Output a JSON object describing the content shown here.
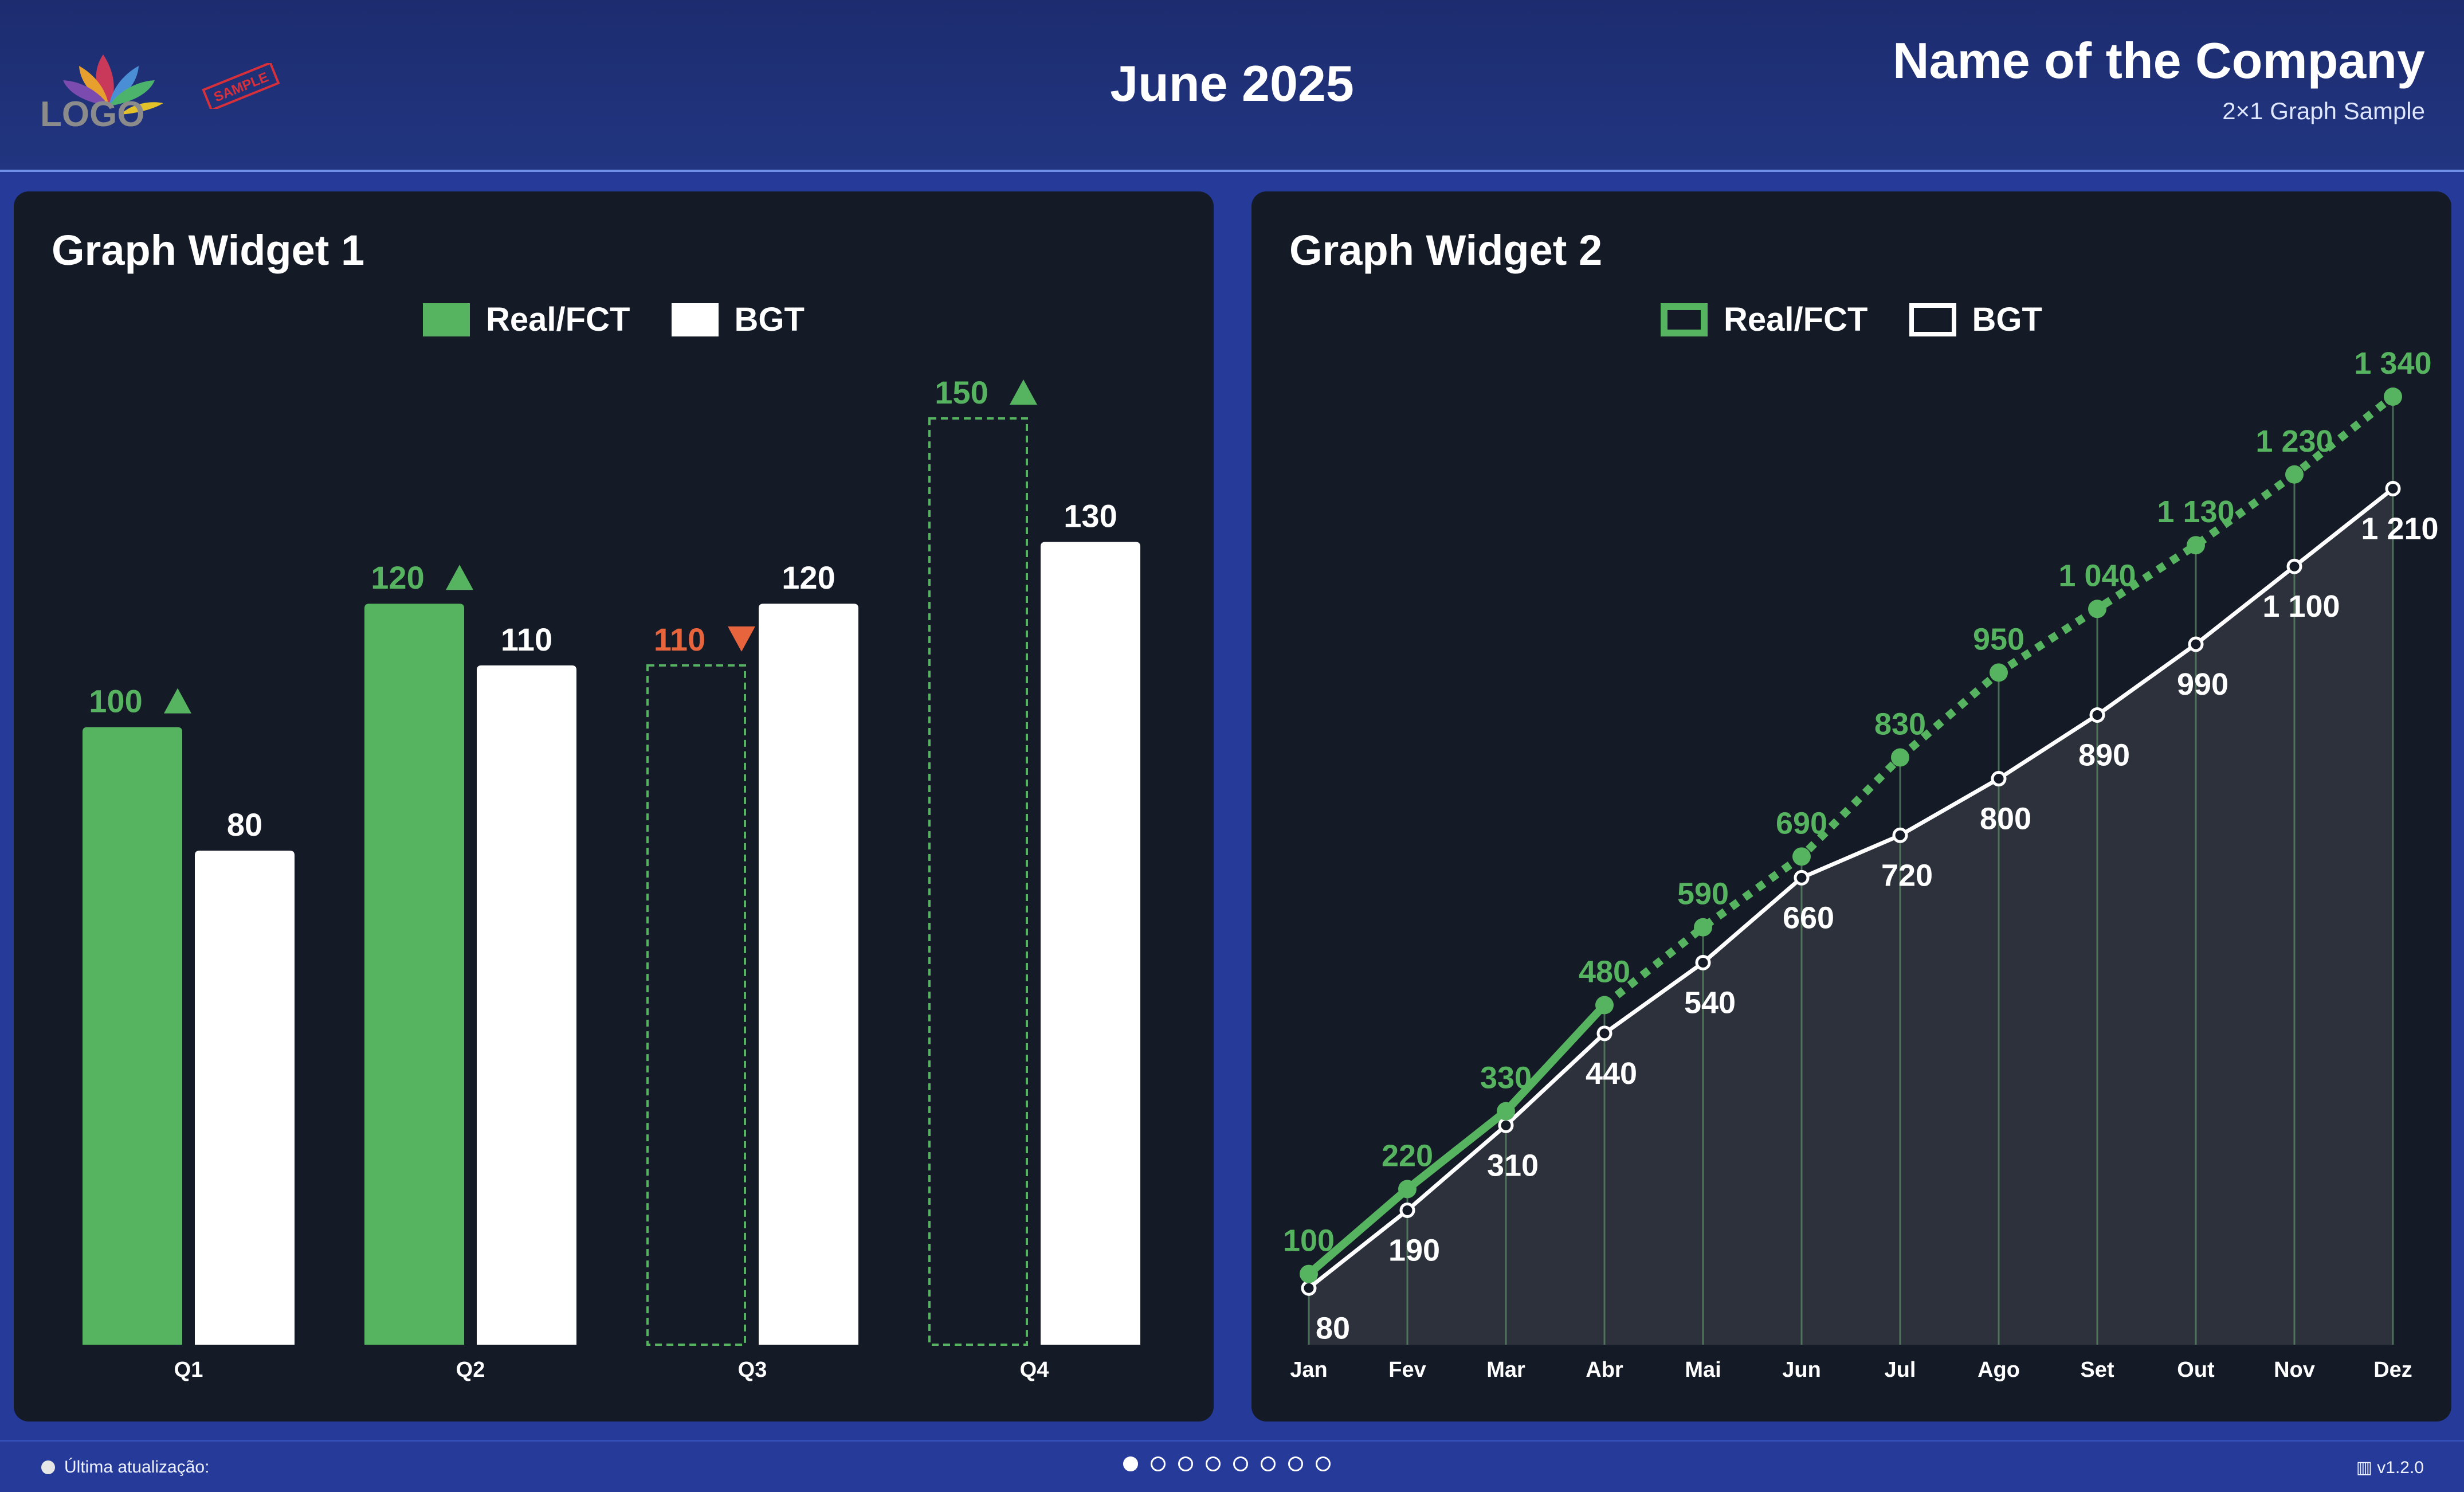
{
  "header": {
    "logo_text": "LOGO",
    "sample_stamp": "SAMPLE",
    "title": "June 2025",
    "company": "Name of the Company",
    "subtitle": "2×1 Graph Sample"
  },
  "colors": {
    "green": "#56b35f",
    "white": "#ffffff",
    "red": "#e8643c",
    "panel": "#141a26",
    "background": "#253a99"
  },
  "widget1": {
    "title": "Graph Widget 1",
    "legend": [
      "Real/FCT",
      "BGT"
    ]
  },
  "widget2": {
    "title": "Graph Widget 2",
    "legend": [
      "Real/FCT",
      "BGT"
    ]
  },
  "chart_data": [
    {
      "type": "bar",
      "title": "Graph Widget 1",
      "categories": [
        "Q1",
        "Q2",
        "Q3",
        "Q4"
      ],
      "series": [
        {
          "name": "Real/FCT",
          "values": [
            100,
            120,
            110,
            150
          ],
          "status": [
            "actual",
            "actual",
            "forecast",
            "forecast"
          ],
          "trend": [
            "up",
            "up",
            "down",
            "up"
          ]
        },
        {
          "name": "BGT",
          "values": [
            80,
            110,
            120,
            130
          ]
        }
      ],
      "ylim": [
        0,
        150
      ],
      "legend": "top-center",
      "grid": false
    },
    {
      "type": "line",
      "title": "Graph Widget 2",
      "categories": [
        "Jan",
        "Fev",
        "Mar",
        "Abr",
        "Mai",
        "Jun",
        "Jul",
        "Ago",
        "Set",
        "Out",
        "Nov",
        "Dez"
      ],
      "series": [
        {
          "name": "Real/FCT",
          "values": [
            100,
            220,
            330,
            480,
            590,
            690,
            830,
            950,
            1040,
            1130,
            1230,
            1340
          ],
          "labels": [
            "100",
            "220",
            "330",
            "480",
            "590",
            "690",
            "830",
            "950",
            "1 040",
            "1 130",
            "1 230",
            "1 340"
          ],
          "actual_count": 4
        },
        {
          "name": "BGT",
          "values": [
            80,
            190,
            310,
            440,
            540,
            660,
            720,
            800,
            890,
            990,
            1100,
            1210
          ],
          "labels": [
            "80",
            "190",
            "310",
            "440",
            "540",
            "660",
            "720",
            "800",
            "890",
            "990",
            "1 100",
            "1 210"
          ]
        }
      ],
      "ylim": [
        0,
        1340
      ],
      "legend": "top-center",
      "grid": false
    }
  ],
  "footer": {
    "status_label": "Última atualização:",
    "version": "v1.2.0",
    "page_count": 8,
    "active_page": 1
  }
}
